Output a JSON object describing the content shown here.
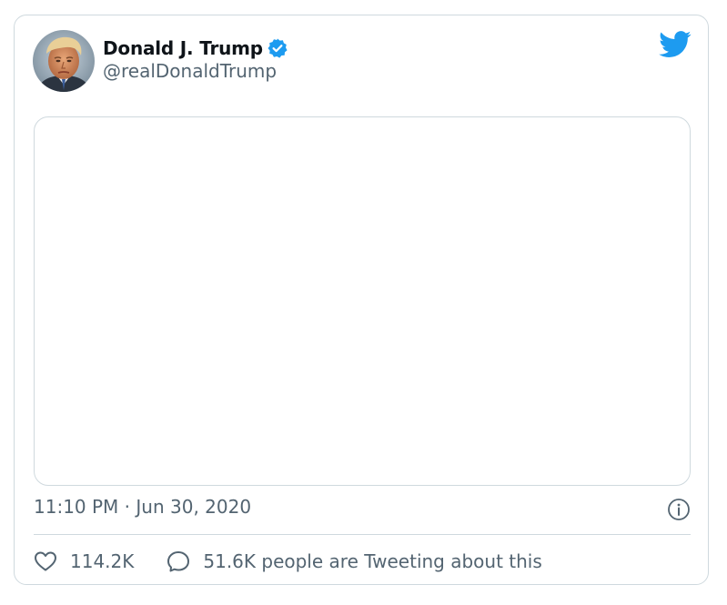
{
  "author": {
    "display_name": "Donald J. Trump",
    "handle": "@realDonaldTrump",
    "verified": true,
    "avatar_icon": "profile-photo"
  },
  "brand": {
    "icon": "twitter-bird-icon",
    "color": "#1d9bf0"
  },
  "tweet": {
    "media": "empty",
    "timestamp": "11:10 PM · Jun 30, 2020"
  },
  "engagement": {
    "likes": "114.2K",
    "talking": "51.6K people are Tweeting about this"
  },
  "colors": {
    "text_primary": "#0f1419",
    "text_secondary": "#536471",
    "border": "#cfd9de",
    "accent": "#1d9bf0"
  }
}
